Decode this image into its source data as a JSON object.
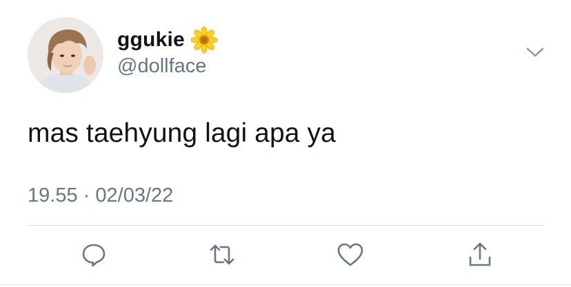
{
  "tweet": {
    "display_name": "ggukie",
    "name_emoji": "sunflower-icon",
    "handle": "@dollface",
    "text": "mas taehyung lagi apa ya",
    "time": "19.55",
    "separator": "·",
    "date": "02/03/22"
  },
  "actions": [
    {
      "name": "reply",
      "icon": "speech-bubble-icon"
    },
    {
      "name": "retweet",
      "icon": "retweet-icon"
    },
    {
      "name": "like",
      "icon": "heart-icon"
    },
    {
      "name": "share",
      "icon": "share-icon"
    }
  ],
  "colors": {
    "text": "#0f1419",
    "secondary": "#657786",
    "icon": "#657786",
    "divider": "#d9dde1"
  }
}
